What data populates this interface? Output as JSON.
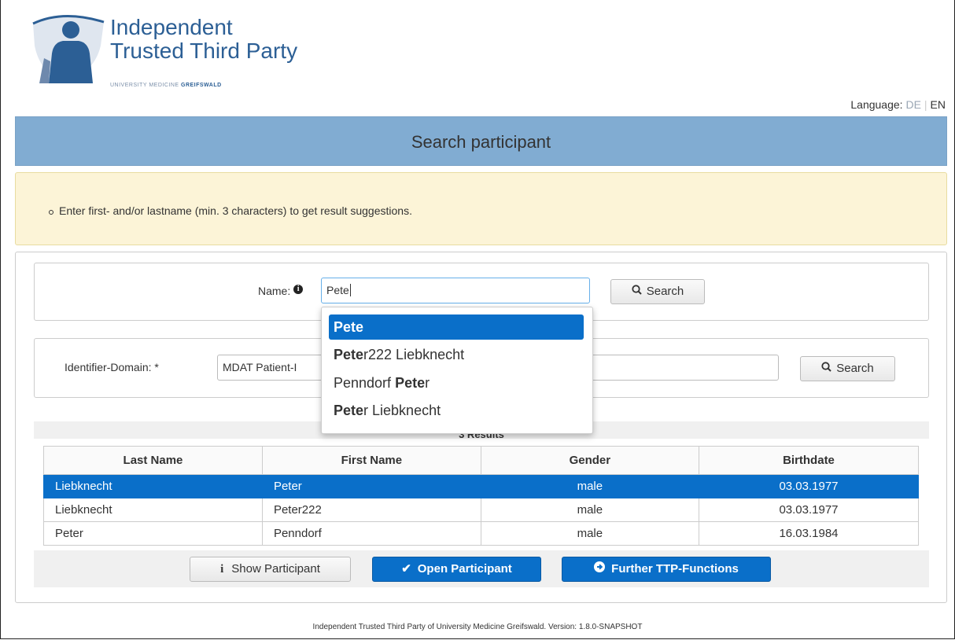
{
  "logo": {
    "line1": "Independent",
    "line2": "Trusted Third Party",
    "sub_a": "UNIVERSITY MEDICINE ",
    "sub_b": "GREIFSWALD",
    "shield_color": "#2c5f95"
  },
  "language": {
    "label": "Language:",
    "de": "DE",
    "sep": "|",
    "en": "EN"
  },
  "title": "Search participant",
  "info": "Enter first- and/or lastname (min. 3 characters) to get result suggestions.",
  "name_search": {
    "label": "Name:",
    "info_icon": "i",
    "value": "Pete",
    "button": "Search"
  },
  "identifier_search": {
    "label": "Identifier-Domain: *",
    "domain_value": "MDAT Patient-I",
    "button": "Search"
  },
  "suggestions": [
    {
      "bold": "Pete",
      "rest": "",
      "prefix": ""
    },
    {
      "prefix": "",
      "bold": "Pete",
      "rest": "r222 Liebknecht"
    },
    {
      "prefix": "Penndorf ",
      "bold": "Pete",
      "rest": "r"
    },
    {
      "prefix": "",
      "bold": "Pete",
      "rest": "r Liebknecht"
    }
  ],
  "results": {
    "header": "3 Results",
    "columns": [
      "Last Name",
      "First Name",
      "Gender",
      "Birthdate"
    ],
    "rows": [
      {
        "last": "Liebknecht",
        "first": "Peter",
        "gender": "male",
        "birth": "03.03.1977"
      },
      {
        "last": "Liebknecht",
        "first": "Peter222",
        "gender": "male",
        "birth": "03.03.1977"
      },
      {
        "last": "Peter",
        "first": "Penndorf",
        "gender": "male",
        "birth": "16.03.1984"
      }
    ]
  },
  "actions": {
    "show": "Show Participant",
    "open": "Open Participant",
    "further": "Further TTP-Functions"
  },
  "footer": "Independent Trusted Third Party of University Medicine Greifswald. Version: 1.8.0-SNAPSHOT"
}
